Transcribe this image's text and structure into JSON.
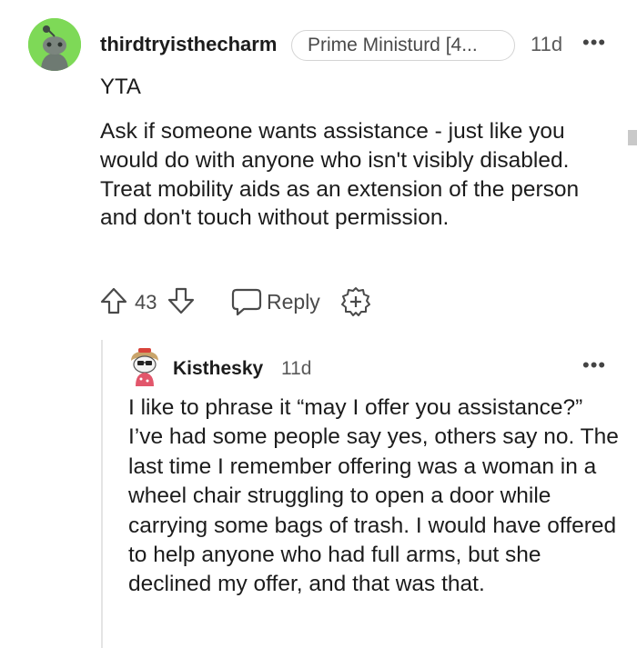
{
  "comment": {
    "username": "thirdtryisthecharm",
    "flair": "Prime Ministurd [4...",
    "time": "11d",
    "more": "•••",
    "verdict": "YTA",
    "body": "Ask if someone wants assistance - just like you would do with anyone who isn't visibly disabled. Treat mobility aids as an extension of the person and don't touch without permission.",
    "vote_count": "43",
    "reply_label": "Reply",
    "icons": {
      "avatar": "snoo-avatar",
      "upvote": "upvote-arrow-icon",
      "downvote": "downvote-arrow-icon",
      "reply": "speech-bubble-icon",
      "award": "award-plus-icon"
    },
    "avatar_color": "#7ed957"
  },
  "reply": {
    "username": "Kisthesky",
    "time": "11d",
    "more": "•••",
    "body": "I like to phrase it “may I offer you assistance?” I’ve had some people say yes, others say no. The last time I remember offering was a woman in a wheel chair struggling to open a door while carrying some bags of trash. I would have offered to help anyone who had full arms, but she declined my offer, and that was that."
  }
}
